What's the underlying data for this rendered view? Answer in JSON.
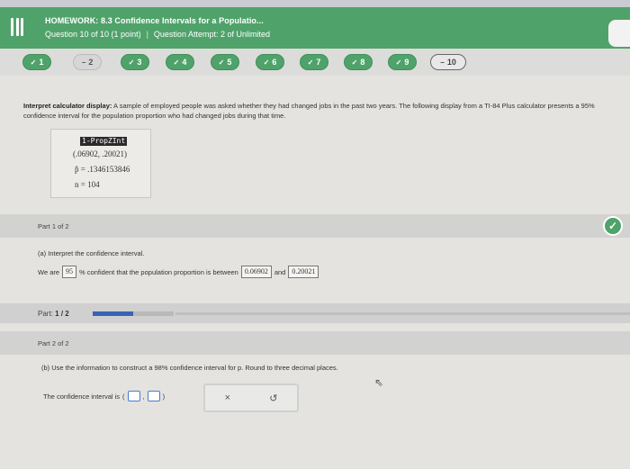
{
  "header": {
    "title": "HOMEWORK: 8.3 Confidence Intervals for a Populatio...",
    "question": "Question 10 of 10 (1 point)",
    "separator": "|",
    "attempt": "Question Attempt: 2 of Unlimited"
  },
  "questions": [
    {
      "mark": "✓",
      "label": "1",
      "state": "done"
    },
    {
      "mark": "−",
      "label": "2",
      "state": "partial"
    },
    {
      "mark": "✓",
      "label": "3",
      "state": "done"
    },
    {
      "mark": "✓",
      "label": "4",
      "state": "done"
    },
    {
      "mark": "✓",
      "label": "5",
      "state": "done"
    },
    {
      "mark": "✓",
      "label": "6",
      "state": "done"
    },
    {
      "mark": "✓",
      "label": "7",
      "state": "done"
    },
    {
      "mark": "✓",
      "label": "8",
      "state": "done"
    },
    {
      "mark": "✓",
      "label": "9",
      "state": "done"
    },
    {
      "mark": "−",
      "label": "10",
      "state": "current"
    }
  ],
  "prompt": {
    "bold": "Interpret calculator display:",
    "text": " A sample of employed people was asked whether they had changed jobs in the past two years. The following display from a TI-84 Plus calculator presents a 95% confidence interval for the population proportion who had changed jobs during that time."
  },
  "calculator": {
    "title": "1-PropZInt",
    "interval": "(.06902, .20021)",
    "phat": "p̂ = .1346153846",
    "n": "n = 104"
  },
  "part1": {
    "header": "Part 1 of 2",
    "question": "(a) Interpret the confidence interval.",
    "sentence_start": "We are",
    "confidence": "95",
    "sentence_mid": "% confident that the population proportion is between",
    "lower": "0.06902",
    "and": "and",
    "upper": "0.20021"
  },
  "progress": {
    "label": "Part:",
    "value": "1 / 2",
    "fraction": 0.5
  },
  "part2": {
    "header": "Part 2 of 2",
    "question": "(b) Use the information to construct a 98% confidence interval for p. Round to three decimal places.",
    "ci_label": "The confidence interval is",
    "tools": {
      "clear": "×",
      "undo": "↺"
    }
  },
  "colors": {
    "accent": "#4fa36a",
    "progress": "#3b63b5"
  }
}
